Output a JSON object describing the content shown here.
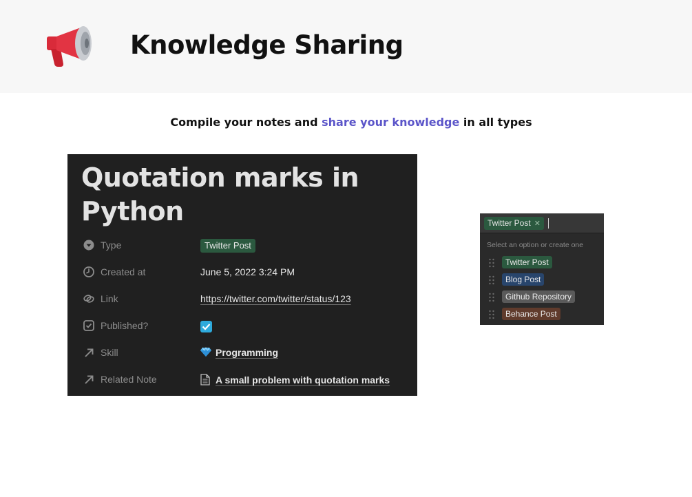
{
  "header": {
    "icon": "megaphone-icon",
    "title": "Knowledge Sharing"
  },
  "subtitle": {
    "before": "Compile your notes and ",
    "link": "share your knowledge",
    "after": " in all types",
    "accent_color": "#5b55c9"
  },
  "card": {
    "title": "Quotation marks in Python",
    "properties": {
      "type": {
        "icon": "select-icon",
        "label": "Type",
        "value": "Twitter Post"
      },
      "created": {
        "icon": "clock-icon",
        "label": "Created at",
        "value": "June 5, 2022 3:24 PM"
      },
      "link": {
        "icon": "link-icon",
        "label": "Link",
        "value": "https://twitter.com/twitter/status/123"
      },
      "published": {
        "icon": "checkbox-icon",
        "label": "Published?",
        "checked": true
      },
      "skill": {
        "icon": "relation-arrow-icon",
        "label": "Skill",
        "value_icon": "gem-icon",
        "value": "Programming"
      },
      "related": {
        "icon": "relation-arrow-icon",
        "label": "Related Note",
        "value_icon": "document-icon",
        "value": "A small problem with quotation marks"
      }
    }
  },
  "dropdown": {
    "selected": "Twitter Post",
    "remove_glyph": "✕",
    "hint": "Select an option or create one",
    "options": [
      {
        "label": "Twitter Post",
        "color": "#2b593f"
      },
      {
        "label": "Blog Post",
        "color": "#28456c"
      },
      {
        "label": "Github Repository",
        "color": "#5a5a5a"
      },
      {
        "label": "Behance Post",
        "color": "#603b2c"
      }
    ]
  }
}
